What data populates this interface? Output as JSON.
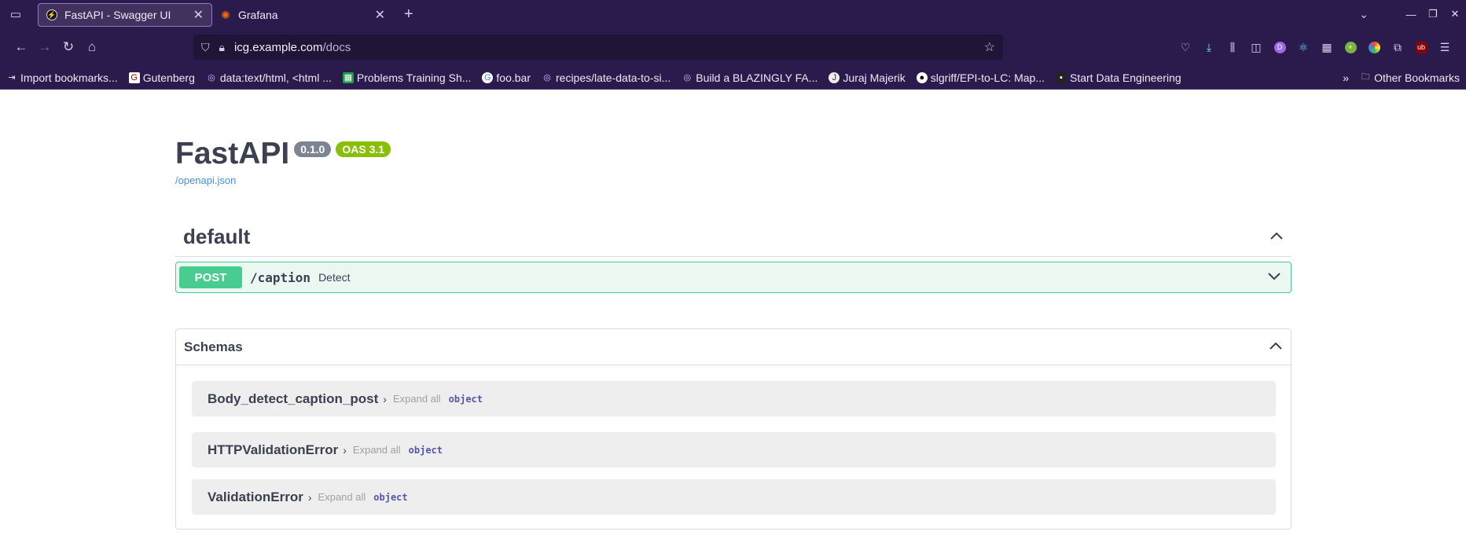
{
  "browser": {
    "tabs": [
      {
        "title": "FastAPI - Swagger UI",
        "active": true
      },
      {
        "title": "Grafana",
        "active": false
      }
    ],
    "url_host": "icg.example.com",
    "url_path": "/docs",
    "bookmarks": [
      "Import bookmarks...",
      "Gutenberg",
      "data:text/html, <html ...",
      "Problems Training Sh...",
      "foo.bar",
      "recipes/late-data-to-si...",
      "Build a BLAZINGLY FA...",
      "Juraj Majerik",
      "slgriff/EPI-to-LC: Map...",
      "Start Data Engineering"
    ],
    "other_bookmarks": "Other Bookmarks",
    "accent_color": "#2b1b4d"
  },
  "api": {
    "title": "FastAPI",
    "version": "0.1.0",
    "oas": "OAS 3.1",
    "spec_link": "/openapi.json"
  },
  "section": {
    "name": "default",
    "operations": [
      {
        "method": "POST",
        "path": "/caption",
        "summary": "Detect",
        "color": "#49cc90"
      }
    ]
  },
  "schemas": {
    "title": "Schemas",
    "items": [
      {
        "name": "Body_detect_caption_post",
        "expand": "Expand all",
        "type": "object"
      },
      {
        "name": "HTTPValidationError",
        "expand": "Expand all",
        "type": "object"
      },
      {
        "name": "ValidationError",
        "expand": "Expand all",
        "type": "object"
      }
    ]
  }
}
